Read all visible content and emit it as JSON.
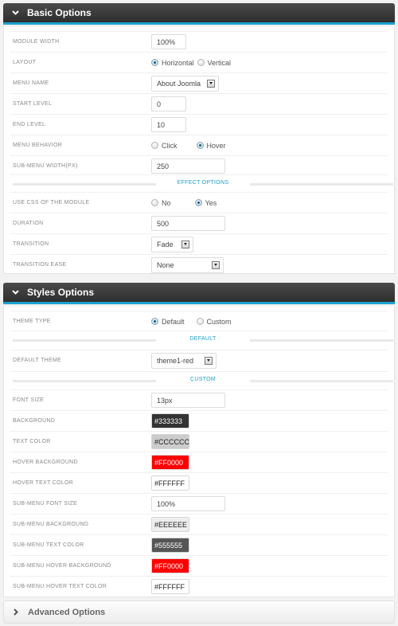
{
  "sections": {
    "basic": {
      "title": "Basic Options",
      "rows": {
        "module_width": {
          "label": "Module Width",
          "value": "100%"
        },
        "layout": {
          "label": "Layout",
          "options": [
            "Horizontal",
            "Vertical"
          ],
          "selected": "Horizontal"
        },
        "menu_name": {
          "label": "Menu Name",
          "value": "About Joomla"
        },
        "start_level": {
          "label": "Start Level",
          "value": "0"
        },
        "end_level": {
          "label": "End Level",
          "value": "10"
        },
        "menu_behavior": {
          "label": "Menu Behavior",
          "options": [
            "Click",
            "Hover"
          ],
          "selected": "Hover"
        },
        "submenu_width": {
          "label": "Sub-Menu Width(PX)",
          "value": "250"
        }
      },
      "effect_divider": "Effect Options",
      "effect_rows": {
        "use_css": {
          "label": "Use CSS of the Module",
          "options": [
            "No",
            "Yes"
          ],
          "selected": "Yes"
        },
        "duration": {
          "label": "Duration",
          "value": "500"
        },
        "transition": {
          "label": "Transition",
          "value": "Fade"
        },
        "transition_ease": {
          "label": "Transition Ease",
          "value": "None"
        }
      }
    },
    "styles": {
      "title": "Styles Options",
      "theme_type": {
        "label": "Theme Type",
        "options": [
          "Default",
          "Custom"
        ],
        "selected": "Default"
      },
      "default_divider": "Default",
      "default_theme": {
        "label": "Default Theme",
        "value": "theme1-red"
      },
      "custom_divider": "Custom",
      "font_size": {
        "label": "Font Size",
        "value": "13px"
      },
      "colors": [
        {
          "label": "Background",
          "value": "#333333",
          "bg": "#333333",
          "fg": "#ffffff"
        },
        {
          "label": "Text Color",
          "value": "#CCCCCC",
          "bg": "#cccccc",
          "fg": "#222222"
        },
        {
          "label": "Hover Background",
          "value": "#FF0000",
          "bg": "#ff0000",
          "fg": "#ffffff"
        },
        {
          "label": "Hover Text Color",
          "value": "#FFFFFF",
          "bg": "#ffffff",
          "fg": "#222222"
        }
      ],
      "submenu_font_size": {
        "label": "Sub-Menu Font Size",
        "value": "100%"
      },
      "submenu_colors": [
        {
          "label": "Sub-Menu Background",
          "value": "#EEEEEE",
          "bg": "#eeeeee",
          "fg": "#222222"
        },
        {
          "label": "Sub-Menu Text Color",
          "value": "#555555",
          "bg": "#555555",
          "fg": "#ffffff"
        },
        {
          "label": "Sub-Menu Hover Background",
          "value": "#FF0000",
          "bg": "#ff0000",
          "fg": "#ffffff"
        },
        {
          "label": "Sub-Menu Hover Text Color",
          "value": "#FFFFFF",
          "bg": "#ffffff",
          "fg": "#222222"
        }
      ]
    },
    "advanced": {
      "title": "Advanced Options"
    }
  },
  "theme": {
    "accent": "#1ba1cf",
    "header_dark": "#333333"
  }
}
